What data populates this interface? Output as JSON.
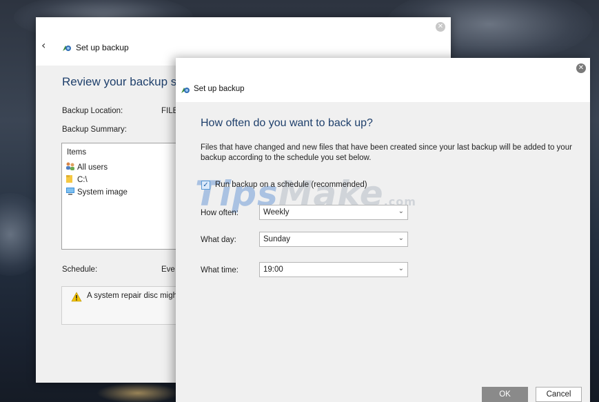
{
  "back_window": {
    "title": "Set up backup",
    "heading": "Review your backup sett",
    "backup_location_label": "Backup Location:",
    "backup_location_value": "FILE",
    "backup_summary_label": "Backup Summary:",
    "items_header": "Items",
    "items": [
      {
        "icon": "users-icon",
        "label": "All users"
      },
      {
        "icon": "folder-icon",
        "label": "C:\\"
      },
      {
        "icon": "system-image-icon",
        "label": "System image"
      }
    ],
    "schedule_label": "Schedule:",
    "schedule_value": "Eve",
    "warning_text": "A system repair disc migh"
  },
  "front_window": {
    "title": "Set up backup",
    "heading": "How often do you want to back up?",
    "description": "Files that have changed and new files that have been created since your last backup will be added to your backup according to the schedule you set below.",
    "schedule_checkbox": {
      "label": "Run backup on a schedule (recommended)",
      "checked": true
    },
    "how_often": {
      "label": "How often:",
      "value": "Weekly"
    },
    "what_day": {
      "label": "What day:",
      "value": "Sunday"
    },
    "what_time": {
      "label": "What time:",
      "value": "19:00"
    },
    "ok_label": "OK",
    "cancel_label": "Cancel"
  },
  "watermark": {
    "tips": "Tips",
    "make": "Make",
    "domain": ".com"
  },
  "colors": {
    "heading": "#1e3f6b",
    "checkbox_accent": "#5a9bd5",
    "ok_disabled": "#8a8a8a"
  }
}
